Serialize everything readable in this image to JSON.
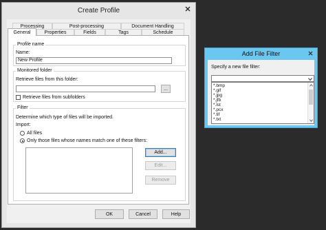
{
  "create_profile": {
    "title": "Create Profile",
    "tabs_row1": [
      {
        "label": "Processing"
      },
      {
        "label": "Post-processing"
      },
      {
        "label": "Document Handling"
      }
    ],
    "tabs_row2": [
      {
        "label": "General"
      },
      {
        "label": "Properties"
      },
      {
        "label": "Fields"
      },
      {
        "label": "Tags"
      },
      {
        "label": "Schedule"
      }
    ],
    "profile_name": {
      "group_title": "Profile name",
      "name_label": "Name:",
      "name_value": "New Profile"
    },
    "monitored_folder": {
      "group_title": "Monitored folder",
      "retrieve_label": "Retrieve files from this folder:",
      "folder_value": "",
      "browse_label": "...",
      "subfolders_label": "Retrieve files from subfolders"
    },
    "filter": {
      "group_title": "Filter",
      "description": "Determine which type of files will be imported.",
      "import_label": "Import:",
      "all_files_label": "All files",
      "only_files_label": "Only those files whose names match one of these filters:",
      "add_label": "Add...",
      "edit_label": "Edit...",
      "remove_label": "Remove"
    },
    "buttons": {
      "ok": "OK",
      "cancel": "Cancel",
      "help": "Help"
    }
  },
  "add_file_filter": {
    "title": "Add File Filter",
    "prompt": "Specify a new file filter:",
    "input_value": "",
    "options": [
      "*.bmp",
      "*.gif",
      "*.jpg",
      "*.jfb",
      "*.lst",
      "*.pcx",
      "*.tif",
      "*.txt"
    ]
  },
  "colors": {
    "desktop": "#2b2b2b",
    "main_frame": "#e6e6e6",
    "filter_dialog_frame": "#6cc7f0",
    "client": "#f0f0f0",
    "default_button_border": "#3c7fb1"
  },
  "icons": {
    "close": "close-icon",
    "dropdown": "chevron-down-icon",
    "scroll_up": "chevron-up-icon"
  }
}
